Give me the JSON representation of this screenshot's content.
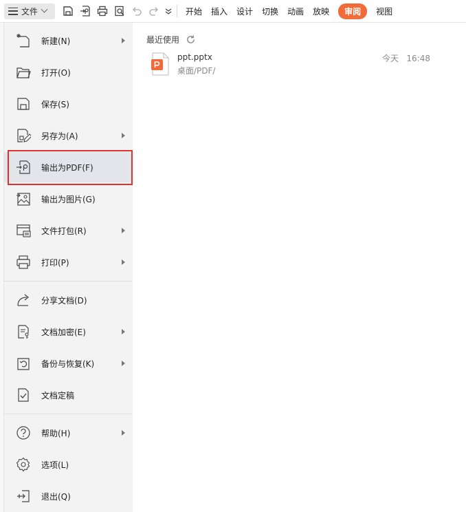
{
  "toolbar": {
    "file_label": "文件",
    "quick_icons": [
      "save-icon",
      "export-pdf-icon",
      "print-icon",
      "print-preview-icon",
      "undo-icon",
      "redo-icon",
      "more-icon"
    ],
    "tabs": [
      {
        "label": "开始",
        "active": false
      },
      {
        "label": "插入",
        "active": false
      },
      {
        "label": "设计",
        "active": false
      },
      {
        "label": "切换",
        "active": false
      },
      {
        "label": "动画",
        "active": false
      },
      {
        "label": "放映",
        "active": false
      },
      {
        "label": "审阅",
        "active": true
      },
      {
        "label": "视图",
        "active": false
      }
    ],
    "accent_color": "#f06c3b"
  },
  "file_menu": {
    "items": [
      {
        "label": "新建(N)",
        "icon": "new-file-icon",
        "submenu": true
      },
      {
        "label": "打开(O)",
        "icon": "folder-open-icon",
        "submenu": false
      },
      {
        "label": "保存(S)",
        "icon": "save-icon",
        "submenu": false
      },
      {
        "label": "另存为(A)",
        "icon": "save-as-icon",
        "submenu": true
      },
      {
        "label": "输出为PDF(F)",
        "icon": "export-pdf-icon",
        "submenu": false,
        "selected": true
      },
      {
        "label": "输出为图片(G)",
        "icon": "export-image-icon",
        "submenu": false
      },
      {
        "label": "文件打包(R)",
        "icon": "package-icon",
        "submenu": true
      },
      {
        "label": "打印(P)",
        "icon": "print-icon",
        "submenu": true
      },
      {
        "label": "分享文档(D)",
        "icon": "share-icon",
        "submenu": false
      },
      {
        "label": "文档加密(E)",
        "icon": "encrypt-icon",
        "submenu": true
      },
      {
        "label": "备份与恢复(K)",
        "icon": "backup-icon",
        "submenu": true
      },
      {
        "label": "文档定稿",
        "icon": "finalize-icon",
        "submenu": false
      },
      {
        "label": "帮助(H)",
        "icon": "help-icon",
        "submenu": true
      },
      {
        "label": "选项(L)",
        "icon": "gear-icon",
        "submenu": false
      },
      {
        "label": "退出(Q)",
        "icon": "exit-icon",
        "submenu": false
      }
    ],
    "highlight_color": "#e2312d"
  },
  "recent": {
    "title": "最近使用",
    "files": [
      {
        "name": "ppt.pptx",
        "path": "桌面/PDF/",
        "time": "今天   16:48",
        "icon": "pptx-file-icon"
      }
    ]
  }
}
